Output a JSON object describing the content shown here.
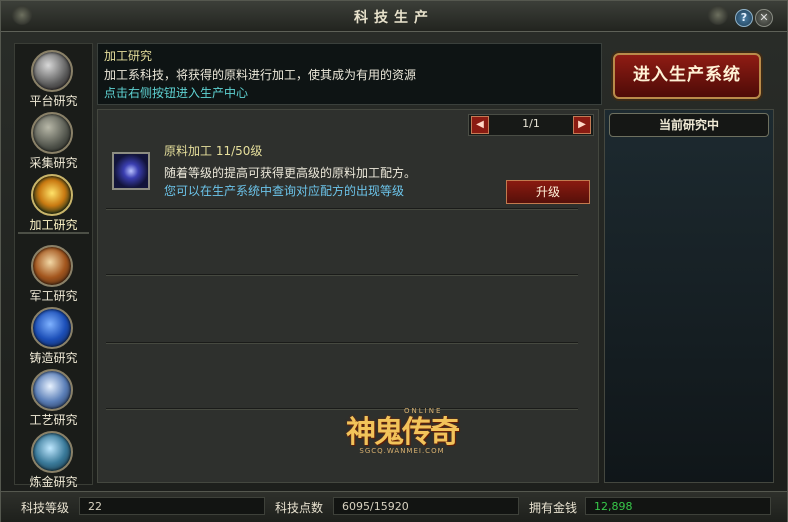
{
  "window": {
    "title": "科技生产",
    "help": "?",
    "close": "✕"
  },
  "sidebar": {
    "items": [
      {
        "label": "平台研究",
        "icon": "anvil-icon"
      },
      {
        "label": "采集研究",
        "icon": "pickaxe-icon"
      },
      {
        "label": "加工研究",
        "icon": "furnace-icon"
      },
      {
        "label": "军工研究",
        "icon": "sword-icon"
      },
      {
        "label": "铸造研究",
        "icon": "shield-icon"
      },
      {
        "label": "工艺研究",
        "icon": "crystal-icon"
      },
      {
        "label": "炼金研究",
        "icon": "alchemy-flask-icon"
      }
    ],
    "active_index": 2
  },
  "info": {
    "title": "加工研究",
    "description": "加工系科技，将获得的原料进行加工，使其成为有用的资源",
    "hint": "点击右侧按钮进入生产中心"
  },
  "enter_button": "进入生产系统",
  "pager": {
    "text": "1/1",
    "prev": "◀",
    "next": "▶"
  },
  "entry": {
    "name": "原料加工  11/50级",
    "description": "随着等级的提高可获得更高级的原料加工配方。",
    "hint": "您可以在生产系统中查询对应配方的出现等级",
    "upgrade": "升级",
    "icon": "vortex-icon"
  },
  "logo": {
    "main": "神鬼传奇",
    "top": "ONLINE",
    "sub": "SGCQ.WANMEI.COM"
  },
  "right_panel": {
    "header": "当前研究中"
  },
  "status": {
    "tech_level_label": "科技等级",
    "tech_level": "22",
    "tech_points_label": "科技点数",
    "tech_points": "6095/15920",
    "money_label": "拥有金钱",
    "money": "12,898"
  },
  "colors": {
    "accent_gold": "#e6df9c",
    "hint_cyan": "#5fd3d3",
    "money_green": "#37c84a",
    "button_red": "#8a1a10"
  }
}
